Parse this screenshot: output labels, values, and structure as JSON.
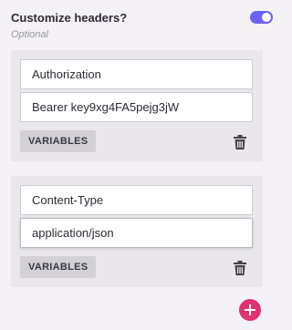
{
  "header": {
    "title": "Customize headers?",
    "subtitle": "Optional",
    "toggle_on": true
  },
  "headers": [
    {
      "key": "Authorization",
      "value": "Bearer key9xg4FA5pejg3jW",
      "variables_label": "VARIABLES"
    },
    {
      "key": "Content-Type",
      "value": "application/json",
      "variables_label": "VARIABLES"
    }
  ],
  "colors": {
    "accent": "#6b63f7",
    "fab": "#e2316f",
    "background": "#f4f2f5",
    "card": "#e9e7eb"
  },
  "icons": {
    "delete": "trash-icon",
    "add": "plus-icon"
  }
}
